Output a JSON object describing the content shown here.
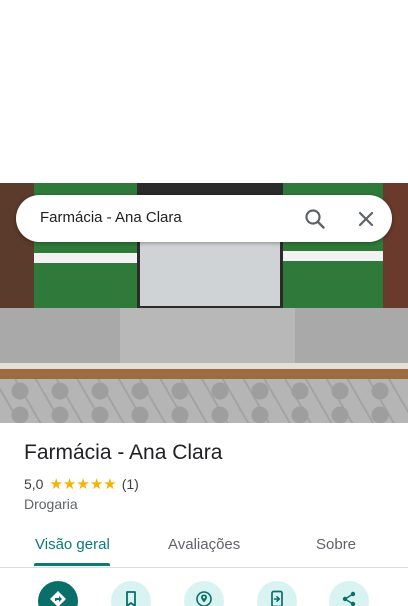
{
  "search": {
    "query": "Farmácia - Ana Clara"
  },
  "place": {
    "name": "Farmácia - Ana Clara",
    "rating": "5,0",
    "stars": 5,
    "review_count": "(1)",
    "category": "Drogaria"
  },
  "tabs": [
    {
      "label": "Visão geral",
      "active": true
    },
    {
      "label": "Avaliações",
      "active": false
    },
    {
      "label": "Sobre",
      "active": false
    }
  ],
  "actions": [
    {
      "icon": "directions-icon"
    },
    {
      "icon": "bookmark-icon"
    },
    {
      "icon": "nearby-icon"
    },
    {
      "icon": "send-to-phone-icon"
    },
    {
      "icon": "share-icon"
    }
  ],
  "colors": {
    "accent": "#0b7a75",
    "star": "#f4b400",
    "action_bg": "#d8f3f1",
    "action_primary_bg": "#0b6f69"
  }
}
